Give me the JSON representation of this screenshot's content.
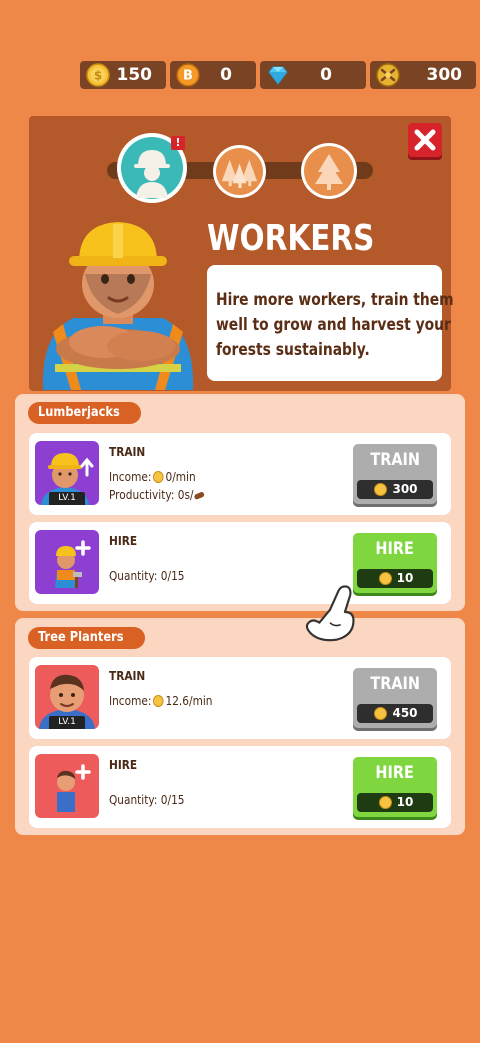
{
  "currencies": [
    {
      "name": "coins",
      "value": "150"
    },
    {
      "name": "bitcoin",
      "value": "0"
    },
    {
      "name": "gems",
      "value": "0"
    },
    {
      "name": "tokens",
      "value": "300"
    }
  ],
  "panel": {
    "title": "WORKERS",
    "description_lines": [
      "Hire more workers, train them",
      "well to grow and harvest your",
      "forests sustainably."
    ],
    "close_label": "X",
    "alert_badge": "!"
  },
  "sections": [
    {
      "tag": "Lumberjacks",
      "cards": [
        {
          "title": "TRAIN",
          "line1_label": "Income:",
          "line1_value": "0/min",
          "line2_label": "Productivity:",
          "line2_value": "0s/",
          "level": "LV.1",
          "button": "TRAIN",
          "cost": "300"
        },
        {
          "title": "HIRE",
          "line1_label": "Quantity:",
          "line1_value": "0/15",
          "button": "HIRE",
          "cost": "10"
        }
      ]
    },
    {
      "tag": "Tree Planters",
      "cards": [
        {
          "title": "TRAIN",
          "line1_label": "Income:",
          "line1_value": "12.6/min",
          "level": "LV.1",
          "button": "TRAIN",
          "cost": "450"
        },
        {
          "title": "HIRE",
          "line1_label": "Quantity:",
          "line1_value": "0/15",
          "button": "HIRE",
          "cost": "10"
        }
      ]
    }
  ],
  "colors": {
    "background": "#ee8748",
    "panel": "#b4592a",
    "section": "#fbd6c0",
    "train_button": "#adadad",
    "hire_button": "#7fd63f",
    "close_button": "#d7242a"
  }
}
